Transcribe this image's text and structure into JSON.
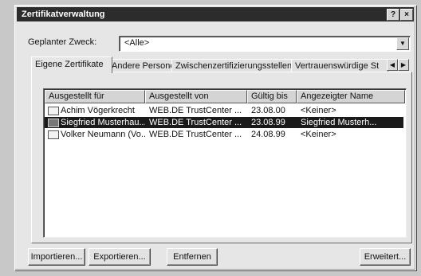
{
  "window": {
    "title": "Zertifikatverwaltung",
    "help_btn": "?",
    "close_btn": "×"
  },
  "purpose": {
    "label": "Geplanter Zweck:",
    "value": "<Alle>"
  },
  "tabs": [
    {
      "label": "Eigene Zertifikate"
    },
    {
      "label": "Andere Personen"
    },
    {
      "label": "Zwischenzertifizierungsstellen"
    },
    {
      "label": "Vertrauenswürdige St"
    }
  ],
  "columns": [
    "Ausgestellt für",
    "Ausgestellt von",
    "Gültig bis",
    "Angezeigter Name"
  ],
  "rows": [
    {
      "issued_to": "Achim Vögerkrecht",
      "issued_by": "WEB.DE TrustCenter ...",
      "valid": "23.08.00",
      "name": "<Keiner>"
    },
    {
      "issued_to": "Siegfried Musterhau...",
      "issued_by": "WEB.DE TrustCenter ...",
      "valid": "23.08.99",
      "name": "Siegfried Musterh..."
    },
    {
      "issued_to": "Volker Neumann (Vo...",
      "issued_by": "WEB.DE TrustCenter ...",
      "valid": "24.08.99",
      "name": "<Keiner>"
    }
  ],
  "buttons": {
    "import": "Importieren...",
    "export": "Exportieren...",
    "remove": "Entfernen",
    "advanced": "Erweitert..."
  }
}
